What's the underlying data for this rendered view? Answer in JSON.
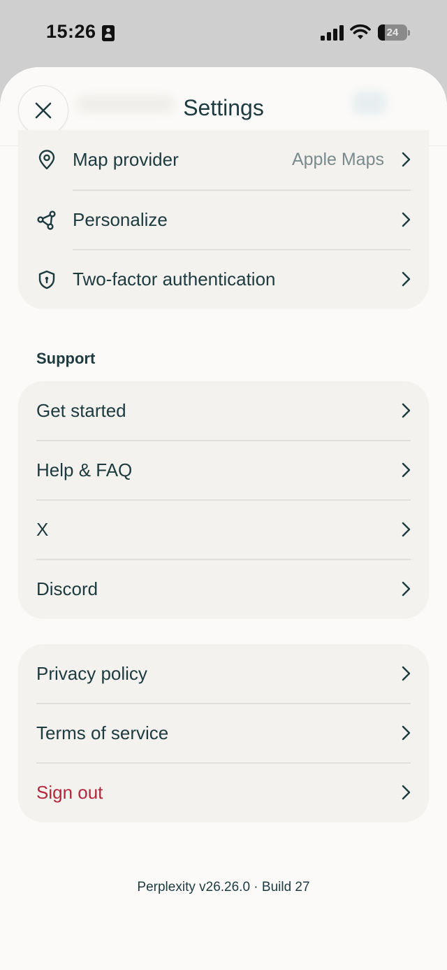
{
  "status_bar": {
    "time": "15:26",
    "battery_level": "24"
  },
  "header": {
    "title": "Settings",
    "close_icon": "close-icon"
  },
  "account_section": {
    "items": [
      {
        "label": "Map provider",
        "value": "Apple Maps",
        "icon": "location-pin-icon"
      },
      {
        "label": "Personalize",
        "icon": "personalize-nodes-icon"
      },
      {
        "label": "Two-factor authentication",
        "icon": "shield-icon"
      }
    ]
  },
  "support_section": {
    "title": "Support",
    "items": [
      {
        "label": "Get started"
      },
      {
        "label": "Help & FAQ"
      },
      {
        "label": "X"
      },
      {
        "label": "Discord"
      }
    ]
  },
  "legal_section": {
    "items": [
      {
        "label": "Privacy policy"
      },
      {
        "label": "Terms of service"
      },
      {
        "label": "Sign out",
        "color": "#b3283c"
      }
    ]
  },
  "footer": {
    "version": "Perplexity v26.26.0 · Build 27"
  },
  "colors": {
    "text": "#1d3b3f",
    "secondary_text": "#7b8a8c",
    "destructive": "#b3283c",
    "card_bg": "#f3f2ef",
    "sheet_bg": "#fbfaf8"
  }
}
